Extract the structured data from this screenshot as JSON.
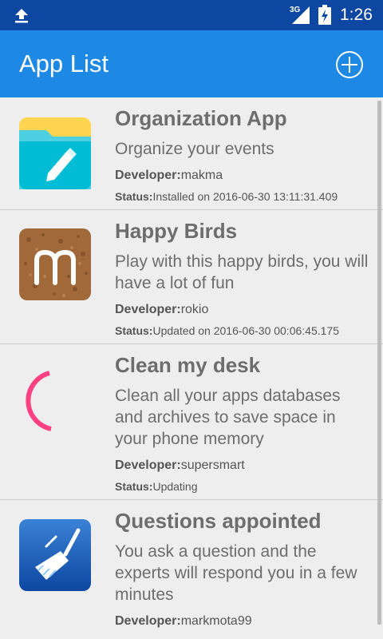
{
  "status_bar": {
    "network_type": "3G",
    "time": "1:26",
    "icons": [
      "upload-icon",
      "signal-icon",
      "battery-charging-icon"
    ]
  },
  "app_bar": {
    "title": "App List",
    "add_icon": "add-circle-icon"
  },
  "colors": {
    "status_bar": "#0d47a1",
    "app_bar": "#1e88e5",
    "background": "#eeeeee",
    "spinner": "#ff4081"
  },
  "apps": [
    {
      "name": "Organization App",
      "description": "Organize your events",
      "developer_label": "Developer:",
      "developer": "makma",
      "status_label": "Status:",
      "status": "Installed on 2016-06-30 13:11:31.409",
      "icon": "folder-pencil-icon"
    },
    {
      "name": "Happy Birds",
      "description": "Play with this happy birds, you will have a lot of fun",
      "developer_label": "Developer:",
      "developer": "rokio",
      "status_label": "Status:",
      "status": "Updated on 2016-06-30 00:06:45.175",
      "icon": "letter-m-cork-icon"
    },
    {
      "name": "Clean my desk",
      "description": "Clean all your apps databases and archives to save space in your phone  memory",
      "developer_label": "Developer:",
      "developer": "supersmart",
      "status_label": "Status:",
      "status": "Updating",
      "icon": "loading-spinner-icon"
    },
    {
      "name": "Questions appointed",
      "description": "You ask a question and the experts will respond you in a few minutes",
      "developer_label": "Developer:",
      "developer": "markmota99",
      "status_label": "",
      "status": "",
      "icon": "broom-icon"
    }
  ]
}
